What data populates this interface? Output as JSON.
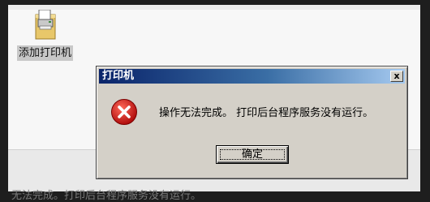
{
  "desktop": {
    "icon_label": "添加打印机"
  },
  "background": {
    "status_text": "无法完成。打印后台程序服务没有运行。"
  },
  "dialog": {
    "title": "打印机",
    "close_label": "x",
    "message": "操作无法完成。 打印后台程序服务没有运行。",
    "ok_label": "确定"
  },
  "colors": {
    "titlebar_start": "#0a246a",
    "titlebar_end": "#a6caf0",
    "error_red": "#d22020"
  }
}
